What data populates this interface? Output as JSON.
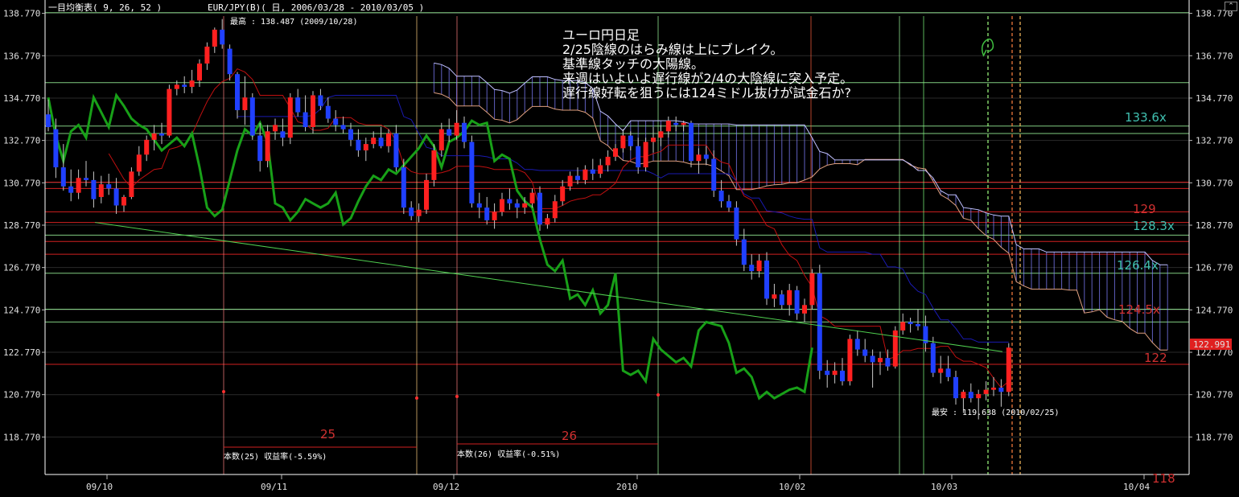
{
  "window": {
    "title_indicator": "一目均衡表( 9, 26, 52 )",
    "title_symbol": "EUR/JPY(B)( 日, 2006/03/28 - 2010/03/05 )",
    "collapse_icon": "chevron-up-icon",
    "collapse_glyph": "⌃"
  },
  "annotations": {
    "max_label": "最高 : 138.487 (2009/10/28)",
    "min_label": "最安 : 119.638 (2010/02/25)",
    "note_lines": [
      "ユーロ円日足",
      "2/25陰線のはらみ線は上にブレイク。",
      "基準線タッチの大陽線。",
      "来週はいよいよ遅行線が2/4の大陰線に突入予定。",
      "遅行線好転を狙うには124ミドル抜けが試金石か?"
    ],
    "count_a_number": "25",
    "count_a_label": "本数(25) 収益率(-5.59%)",
    "count_b_number": "26",
    "count_b_label": "本数(26) 収益率(-0.51%)"
  },
  "price_labels": {
    "current": "122.991",
    "levels": [
      "133.6x",
      "129",
      "128.3x",
      "126.4x",
      "124.5x",
      "122",
      "118"
    ]
  },
  "colors": {
    "up": "#ff2020",
    "down": "#2040ff",
    "chikou": "#18a018",
    "kijun": "#1a1ab0",
    "tenkan": "#c01010",
    "cloud_edge": "#e0a080",
    "grid": "#606060",
    "hline_red": "#d02020",
    "hline_green": "#a0ffa0",
    "vline_green": "#80ff80",
    "vline_orange": "#ff8040",
    "level_teal": "#40c0b0",
    "level_red": "#d03030"
  },
  "chart_data": {
    "type": "candlestick",
    "indicator": "Ichimoku (9, 26, 52)",
    "symbol": "EUR/JPY",
    "ylim": [
      117.0,
      139.4
    ],
    "y_ticks": [
      138.77,
      136.77,
      134.77,
      132.77,
      130.77,
      128.77,
      126.77,
      124.77,
      122.77,
      120.77,
      118.77
    ],
    "x_labels": [
      "09/10",
      "09/11",
      "09/12",
      "2010",
      "10/02",
      "10/03",
      "10/04"
    ],
    "candles": [
      [
        134.0,
        134.7,
        133.2,
        133.4
      ],
      [
        133.3,
        133.8,
        131.0,
        131.5
      ],
      [
        131.5,
        132.6,
        130.4,
        130.6
      ],
      [
        130.6,
        131.4,
        129.9,
        130.3
      ],
      [
        130.3,
        131.4,
        130.0,
        131.0
      ],
      [
        131.0,
        131.8,
        130.6,
        130.9
      ],
      [
        130.9,
        131.3,
        129.6,
        130.0
      ],
      [
        130.1,
        131.1,
        129.8,
        130.7
      ],
      [
        130.7,
        131.2,
        130.2,
        130.5
      ],
      [
        130.5,
        131.0,
        129.3,
        129.7
      ],
      [
        129.7,
        130.2,
        129.4,
        130.1
      ],
      [
        130.1,
        131.5,
        130.0,
        131.3
      ],
      [
        131.3,
        132.5,
        131.1,
        132.1
      ],
      [
        132.1,
        133.0,
        131.8,
        132.8
      ],
      [
        132.8,
        133.5,
        132.3,
        133.1
      ],
      [
        133.1,
        133.6,
        132.6,
        133.0
      ],
      [
        133.0,
        135.4,
        132.9,
        135.2
      ],
      [
        135.2,
        135.6,
        134.9,
        135.4
      ],
      [
        135.4,
        135.8,
        135.0,
        135.3
      ],
      [
        135.3,
        136.1,
        135.0,
        135.6
      ],
      [
        135.6,
        136.6,
        135.3,
        136.4
      ],
      [
        136.4,
        137.4,
        136.1,
        137.2
      ],
      [
        137.2,
        138.1,
        136.9,
        138.0
      ],
      [
        138.0,
        138.5,
        137.1,
        137.3
      ],
      [
        137.1,
        137.3,
        135.6,
        135.9
      ],
      [
        135.9,
        136.0,
        133.8,
        134.2
      ],
      [
        134.2,
        135.8,
        133.5,
        134.8
      ],
      [
        134.8,
        135.0,
        132.8,
        133.0
      ],
      [
        133.0,
        133.6,
        131.3,
        131.8
      ],
      [
        131.8,
        133.5,
        131.5,
        133.2
      ],
      [
        133.2,
        133.8,
        132.8,
        133.5
      ],
      [
        133.2,
        133.8,
        132.5,
        132.9
      ],
      [
        132.9,
        135.0,
        132.6,
        134.8
      ],
      [
        134.8,
        135.2,
        133.9,
        134.1
      ],
      [
        134.1,
        134.9,
        133.2,
        133.4
      ],
      [
        133.4,
        135.1,
        133.1,
        134.9
      ],
      [
        134.9,
        135.2,
        134.2,
        134.4
      ],
      [
        134.4,
        134.8,
        133.6,
        133.8
      ],
      [
        133.8,
        134.2,
        133.2,
        133.5
      ],
      [
        133.5,
        133.9,
        133.1,
        133.3
      ],
      [
        133.3,
        133.6,
        132.5,
        132.8
      ],
      [
        132.8,
        133.3,
        132.0,
        132.3
      ],
      [
        132.3,
        132.9,
        131.8,
        132.6
      ],
      [
        132.6,
        133.2,
        132.4,
        132.9
      ],
      [
        132.9,
        133.4,
        132.4,
        132.5
      ],
      [
        132.5,
        133.3,
        132.2,
        133.1
      ],
      [
        133.1,
        133.5,
        131.3,
        131.5
      ],
      [
        131.5,
        131.9,
        129.3,
        129.6
      ],
      [
        129.6,
        129.9,
        129.0,
        129.2
      ],
      [
        129.2,
        129.8,
        128.9,
        129.5
      ],
      [
        129.5,
        131.2,
        129.3,
        130.9
      ],
      [
        130.9,
        132.6,
        130.6,
        132.3
      ],
      [
        132.3,
        133.6,
        132.0,
        133.3
      ],
      [
        133.3,
        133.8,
        132.7,
        133.0
      ],
      [
        133.0,
        134.2,
        132.8,
        133.6
      ],
      [
        133.6,
        133.9,
        132.4,
        132.7
      ],
      [
        132.7,
        133.0,
        129.6,
        129.8
      ],
      [
        129.8,
        130.3,
        129.1,
        129.6
      ],
      [
        129.6,
        130.1,
        128.8,
        129.0
      ],
      [
        129.0,
        129.8,
        128.6,
        129.4
      ],
      [
        129.4,
        130.3,
        129.2,
        130.0
      ],
      [
        130.0,
        130.5,
        129.5,
        129.8
      ],
      [
        129.8,
        130.0,
        129.1,
        129.6
      ],
      [
        129.6,
        130.1,
        129.3,
        129.8
      ],
      [
        129.8,
        130.5,
        129.6,
        130.3
      ],
      [
        130.3,
        130.6,
        128.5,
        128.8
      ],
      [
        128.8,
        129.3,
        128.6,
        129.1
      ],
      [
        129.1,
        130.2,
        128.9,
        129.9
      ],
      [
        129.9,
        130.9,
        129.7,
        130.6
      ],
      [
        130.6,
        131.3,
        130.4,
        131.1
      ],
      [
        131.1,
        131.5,
        130.7,
        130.9
      ],
      [
        130.9,
        131.6,
        130.7,
        131.4
      ],
      [
        131.4,
        131.9,
        130.9,
        131.2
      ],
      [
        131.2,
        131.9,
        131.0,
        131.6
      ],
      [
        131.6,
        132.3,
        131.3,
        132.0
      ],
      [
        132.0,
        132.6,
        131.8,
        132.4
      ],
      [
        132.4,
        133.3,
        132.2,
        133.0
      ],
      [
        133.0,
        133.2,
        132.3,
        132.5
      ],
      [
        132.5,
        132.9,
        131.2,
        131.5
      ],
      [
        131.5,
        132.9,
        131.3,
        132.7
      ],
      [
        132.7,
        133.4,
        132.2,
        132.9
      ],
      [
        132.9,
        133.5,
        132.5,
        133.2
      ],
      [
        133.2,
        133.9,
        132.9,
        133.7
      ],
      [
        133.6,
        133.9,
        133.2,
        133.5
      ],
      [
        133.5,
        133.7,
        133.2,
        133.6
      ],
      [
        133.6,
        133.7,
        131.5,
        131.8
      ],
      [
        131.8,
        132.4,
        131.2,
        132.1
      ],
      [
        132.1,
        132.5,
        131.6,
        131.9
      ],
      [
        131.9,
        132.3,
        130.1,
        130.4
      ],
      [
        130.4,
        130.9,
        129.6,
        129.9
      ],
      [
        129.9,
        130.2,
        129.4,
        129.6
      ],
      [
        129.6,
        129.9,
        127.8,
        128.1
      ],
      [
        128.1,
        128.6,
        126.6,
        126.9
      ],
      [
        126.9,
        127.4,
        126.2,
        126.6
      ],
      [
        126.6,
        127.4,
        126.3,
        127.1
      ],
      [
        127.1,
        127.5,
        125.0,
        125.3
      ],
      [
        125.3,
        126.0,
        124.9,
        125.5
      ],
      [
        125.5,
        125.7,
        124.8,
        125.0
      ],
      [
        125.0,
        126.0,
        124.5,
        125.7
      ],
      [
        125.7,
        125.9,
        124.3,
        124.6
      ],
      [
        124.6,
        125.3,
        124.2,
        125.0
      ],
      [
        125.0,
        126.7,
        124.8,
        126.5
      ],
      [
        126.5,
        126.9,
        121.5,
        121.9
      ],
      [
        121.9,
        122.4,
        121.1,
        121.7
      ],
      [
        121.7,
        122.3,
        121.3,
        121.9
      ],
      [
        121.9,
        122.5,
        121.2,
        121.4
      ],
      [
        121.4,
        123.6,
        121.2,
        123.4
      ],
      [
        123.4,
        123.8,
        122.6,
        122.9
      ],
      [
        122.9,
        123.4,
        122.3,
        122.6
      ],
      [
        122.6,
        122.9,
        121.1,
        122.3
      ],
      [
        122.3,
        122.8,
        121.7,
        122.5
      ],
      [
        122.5,
        122.9,
        121.9,
        122.1
      ],
      [
        122.1,
        124.0,
        122.0,
        123.8
      ],
      [
        123.8,
        124.6,
        123.6,
        124.2
      ],
      [
        124.2,
        124.4,
        123.7,
        124.1
      ],
      [
        124.1,
        124.8,
        123.8,
        124.0
      ],
      [
        124.0,
        124.5,
        122.8,
        123.2
      ],
      [
        123.2,
        123.5,
        121.6,
        121.8
      ],
      [
        121.8,
        122.6,
        121.3,
        122.0
      ],
      [
        122.0,
        122.6,
        121.4,
        121.6
      ],
      [
        121.6,
        121.9,
        120.3,
        120.6
      ],
      [
        120.6,
        121.0,
        119.9,
        120.9
      ],
      [
        120.9,
        121.3,
        120.4,
        120.6
      ],
      [
        120.6,
        121.0,
        119.6,
        120.8
      ],
      [
        120.8,
        121.4,
        120.5,
        121.0
      ],
      [
        121.0,
        121.6,
        120.7,
        121.1
      ],
      [
        121.1,
        121.5,
        120.2,
        120.9
      ],
      [
        120.9,
        123.2,
        120.7,
        122.99
      ]
    ]
  }
}
